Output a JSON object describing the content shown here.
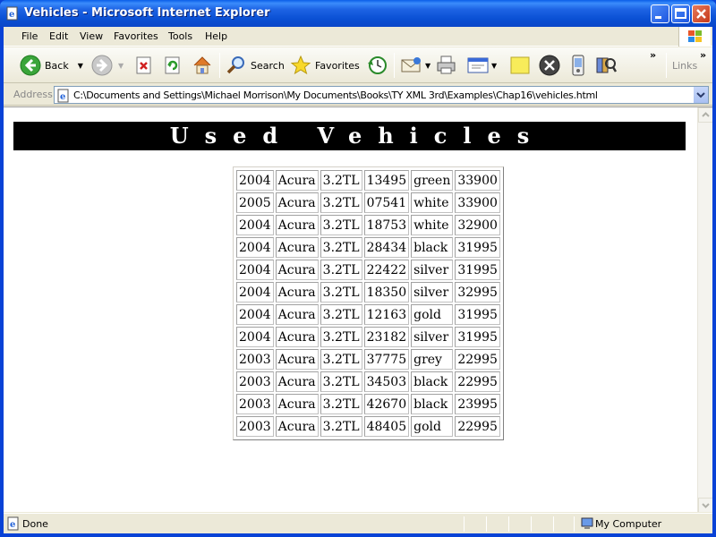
{
  "window": {
    "title": "Vehicles - Microsoft Internet Explorer"
  },
  "menu": {
    "items": [
      {
        "label": "File"
      },
      {
        "label": "Edit"
      },
      {
        "label": "View"
      },
      {
        "label": "Favorites"
      },
      {
        "label": "Tools"
      },
      {
        "label": "Help"
      }
    ]
  },
  "toolbar": {
    "back_label": "Back",
    "search_label": "Search",
    "favorites_label": "Favorites",
    "links_label": "Links",
    "overflow": "»"
  },
  "address": {
    "label": "Address",
    "url": "C:\\Documents and Settings\\Michael Morrison\\My Documents\\Books\\TY XML 3rd\\Examples\\Chap16\\vehicles.html"
  },
  "page": {
    "heading": "Used Vehicles",
    "vehicles": [
      [
        "2004",
        "Acura",
        "3.2TL",
        "13495",
        "green",
        "33900"
      ],
      [
        "2005",
        "Acura",
        "3.2TL",
        "07541",
        "white",
        "33900"
      ],
      [
        "2004",
        "Acura",
        "3.2TL",
        "18753",
        "white",
        "32900"
      ],
      [
        "2004",
        "Acura",
        "3.2TL",
        "28434",
        "black",
        "31995"
      ],
      [
        "2004",
        "Acura",
        "3.2TL",
        "22422",
        "silver",
        "31995"
      ],
      [
        "2004",
        "Acura",
        "3.2TL",
        "18350",
        "silver",
        "32995"
      ],
      [
        "2004",
        "Acura",
        "3.2TL",
        "12163",
        "gold",
        "31995"
      ],
      [
        "2004",
        "Acura",
        "3.2TL",
        "23182",
        "silver",
        "31995"
      ],
      [
        "2003",
        "Acura",
        "3.2TL",
        "37775",
        "grey",
        "22995"
      ],
      [
        "2003",
        "Acura",
        "3.2TL",
        "34503",
        "black",
        "22995"
      ],
      [
        "2003",
        "Acura",
        "3.2TL",
        "42670",
        "black",
        "23995"
      ],
      [
        "2003",
        "Acura",
        "3.2TL",
        "48405",
        "gold",
        "22995"
      ]
    ]
  },
  "status": {
    "text": "Done",
    "zone": "My Computer"
  },
  "colors": {
    "titlebar": "#0a50d4",
    "banner_bg": "#000000",
    "banner_fg": "#ffffff"
  }
}
